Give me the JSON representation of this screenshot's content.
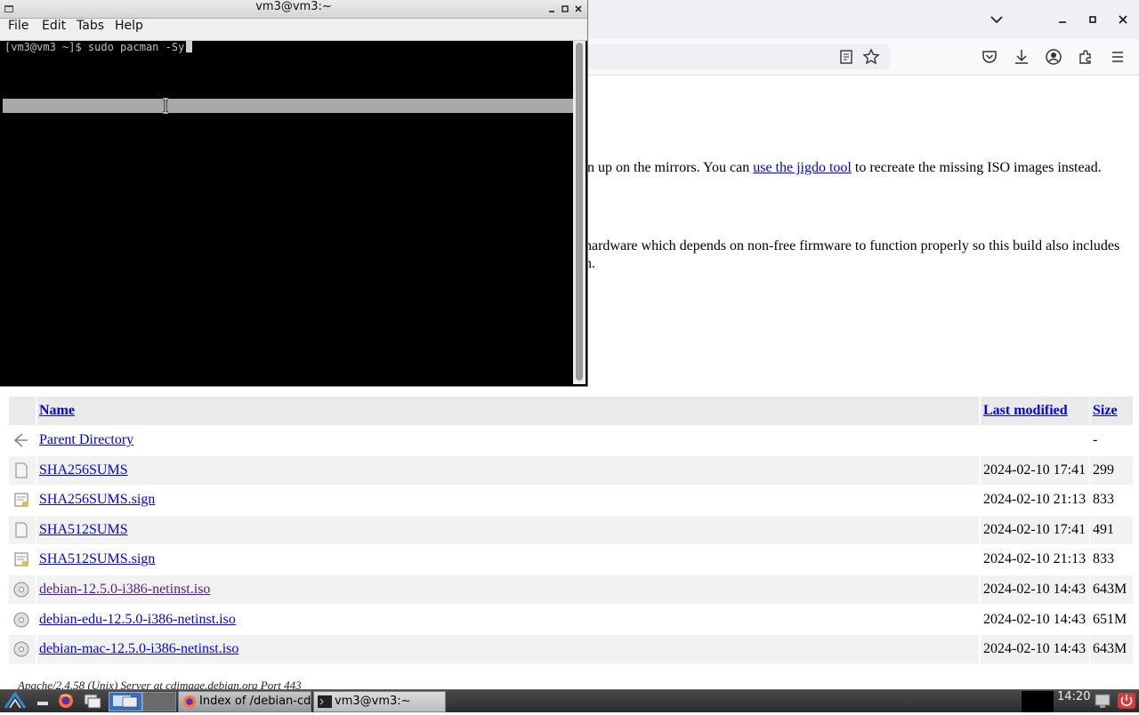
{
  "firefox": {
    "paragraph1_prefix": "n up on the mirrors. You can ",
    "paragraph1_link": "use the jigdo tool",
    "paragraph1_suffix": " to recreate the missing ISO images instead.",
    "paragraph2_line1": " hardware which depends on non-free firmware to function properly so this build also includes",
    "paragraph2_line2": "n.",
    "table": {
      "headers": {
        "name": "Name",
        "modified": "Last modified",
        "size": "Size"
      },
      "rows": [
        {
          "icon": "back-icon",
          "name": "Parent Directory",
          "modified": "",
          "size": "-"
        },
        {
          "icon": "text-file-icon",
          "name": "SHA256SUMS",
          "modified": "2024-02-10 17:41",
          "size": "299"
        },
        {
          "icon": "signature-file-icon",
          "name": "SHA256SUMS.sign",
          "modified": "2024-02-10 21:13",
          "size": "833"
        },
        {
          "icon": "text-file-icon",
          "name": "SHA512SUMS",
          "modified": "2024-02-10 17:41",
          "size": "491"
        },
        {
          "icon": "signature-file-icon",
          "name": "SHA512SUMS.sign",
          "modified": "2024-02-10 21:13",
          "size": "833"
        },
        {
          "icon": "disc-icon",
          "name": "debian-12.5.0-i386-netinst.iso",
          "modified": "2024-02-10 14:43",
          "size": "643M",
          "visited": true
        },
        {
          "icon": "disc-icon",
          "name": "debian-edu-12.5.0-i386-netinst.iso",
          "modified": "2024-02-10 14:43",
          "size": "651M"
        },
        {
          "icon": "disc-icon",
          "name": "debian-mac-12.5.0-i386-netinst.iso",
          "modified": "2024-02-10 14:43",
          "size": "643M"
        }
      ]
    },
    "footer": "Apache/2.4.58 (Unix) Server at cdimage.debian.org Port 443"
  },
  "terminal": {
    "title": "vm3@vm3:~",
    "menu": [
      "File",
      "Edit",
      "Tabs",
      "Help"
    ],
    "prompt_line": "[vm3@vm3 ~]$ sudo pacman -Sy"
  },
  "taskbar": {
    "tasks": [
      {
        "label": "Index of /debian-cd...",
        "icon": "firefox-icon"
      },
      {
        "label": "vm3@vm3:~",
        "icon": "terminal-icon"
      }
    ],
    "clock": "14:20"
  },
  "colors": {
    "link": "#0000ee",
    "visited": "#551a8b",
    "terminal_bg": "#000000",
    "terminal_fg": "#bfbfbf"
  }
}
